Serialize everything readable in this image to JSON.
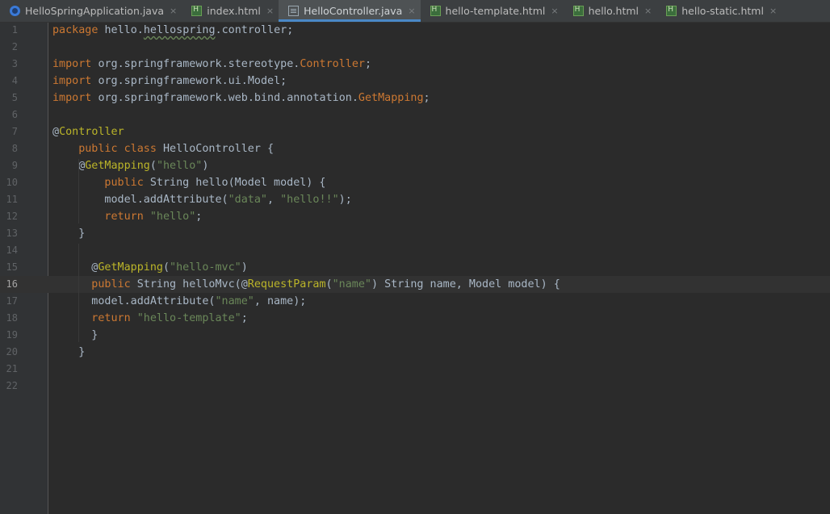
{
  "tabs": [
    {
      "label": "HelloSpringApplication.java",
      "icon": "spring-app-icon",
      "active": false
    },
    {
      "label": "index.html",
      "icon": "html-file-icon",
      "active": false
    },
    {
      "label": "HelloController.java",
      "icon": "java-file-icon",
      "active": true
    },
    {
      "label": "hello-template.html",
      "icon": "html-file-icon",
      "active": false
    },
    {
      "label": "hello.html",
      "icon": "html-file-icon",
      "active": false
    },
    {
      "label": "hello-static.html",
      "icon": "html-file-icon",
      "active": false
    }
  ],
  "close_glyph": "×",
  "current_line": 16,
  "lines": [
    {
      "n": "1",
      "indent": 0,
      "tokens": [
        [
          "kw",
          "package "
        ],
        [
          "plain",
          "hello."
        ],
        [
          "squig",
          "hellospring"
        ],
        [
          "plain",
          ".controller;"
        ]
      ]
    },
    {
      "n": "2",
      "indent": 0,
      "tokens": []
    },
    {
      "n": "3",
      "indent": 0,
      "tokens": [
        [
          "kw",
          "import "
        ],
        [
          "plain",
          "org.springframework.stereotype."
        ],
        [
          "kw",
          "Controller"
        ],
        [
          "plain",
          ";"
        ]
      ]
    },
    {
      "n": "4",
      "indent": 0,
      "tokens": [
        [
          "kw",
          "import "
        ],
        [
          "plain",
          "org.springframework.ui.Model;"
        ]
      ]
    },
    {
      "n": "5",
      "indent": 0,
      "tokens": [
        [
          "kw",
          "import "
        ],
        [
          "plain",
          "org.springframework.web.bind.annotation."
        ],
        [
          "kw",
          "GetMapping"
        ],
        [
          "plain",
          ";"
        ]
      ]
    },
    {
      "n": "6",
      "indent": 0,
      "tokens": []
    },
    {
      "n": "7",
      "indent": 0,
      "tokens": [
        [
          "plain",
          "@"
        ],
        [
          "ann",
          "Controller"
        ]
      ]
    },
    {
      "n": "8",
      "indent": 4,
      "tokens": [
        [
          "kw",
          "public class "
        ],
        [
          "plain",
          "HelloController {"
        ]
      ]
    },
    {
      "n": "9",
      "indent": 4,
      "tokens": [
        [
          "plain",
          "@"
        ],
        [
          "ann",
          "GetMapping"
        ],
        [
          "plain",
          "("
        ],
        [
          "str",
          "\"hello\""
        ],
        [
          "plain",
          ")"
        ]
      ]
    },
    {
      "n": "10",
      "indent": 8,
      "tokens": [
        [
          "kw",
          "public "
        ],
        [
          "plain",
          "String hello(Model model) {"
        ]
      ]
    },
    {
      "n": "11",
      "indent": 8,
      "tokens": [
        [
          "plain",
          "model.addAttribute("
        ],
        [
          "str",
          "\"data\""
        ],
        [
          "plain",
          ", "
        ],
        [
          "str",
          "\"hello!!\""
        ],
        [
          "plain",
          ");"
        ]
      ]
    },
    {
      "n": "12",
      "indent": 8,
      "tokens": [
        [
          "kw",
          "return "
        ],
        [
          "str",
          "\"hello\""
        ],
        [
          "plain",
          ";"
        ]
      ]
    },
    {
      "n": "13",
      "indent": 4,
      "tokens": [
        [
          "plain",
          "}"
        ]
      ]
    },
    {
      "n": "14",
      "indent": 0,
      "tokens": []
    },
    {
      "n": "15",
      "indent": 6,
      "tokens": [
        [
          "plain",
          "@"
        ],
        [
          "ann",
          "GetMapping"
        ],
        [
          "plain",
          "("
        ],
        [
          "str",
          "\"hello-mvc\""
        ],
        [
          "plain",
          ")"
        ]
      ]
    },
    {
      "n": "16",
      "indent": 6,
      "tokens": [
        [
          "kw",
          "public "
        ],
        [
          "plain",
          "String helloMvc(@"
        ],
        [
          "ann",
          "RequestParam"
        ],
        [
          "plain",
          "("
        ],
        [
          "str",
          "\"name\""
        ],
        [
          "plain",
          ") String name, Model model) {"
        ]
      ]
    },
    {
      "n": "17",
      "indent": 6,
      "tokens": [
        [
          "plain",
          "model.addAttribute("
        ],
        [
          "str",
          "\"name\""
        ],
        [
          "plain",
          ", name);"
        ]
      ]
    },
    {
      "n": "18",
      "indent": 6,
      "tokens": [
        [
          "kw",
          "return "
        ],
        [
          "str",
          "\"hello-template\""
        ],
        [
          "plain",
          ";"
        ]
      ]
    },
    {
      "n": "19",
      "indent": 6,
      "tokens": [
        [
          "plain",
          "}"
        ]
      ]
    },
    {
      "n": "20",
      "indent": 4,
      "tokens": [
        [
          "plain",
          "}"
        ]
      ]
    },
    {
      "n": "21",
      "indent": 0,
      "tokens": []
    },
    {
      "n": "22",
      "indent": 0,
      "tokens": []
    }
  ],
  "colors": {
    "keyword": "#cc7832",
    "string": "#6a8759",
    "annotation": "#bbb529",
    "plain": "#a9b7c6",
    "background": "#2b2b2b"
  }
}
